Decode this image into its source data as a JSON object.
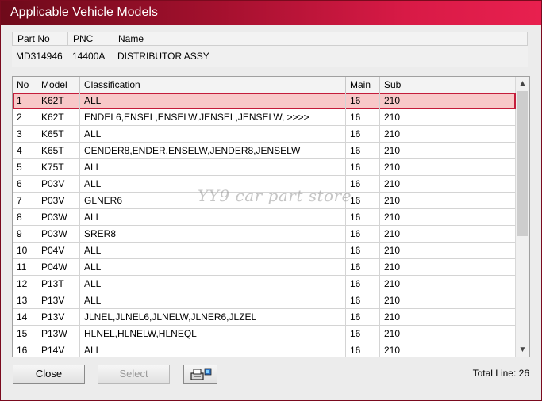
{
  "window": {
    "title": "Applicable Vehicle Models"
  },
  "part_header": {
    "columns": [
      "Part No",
      "PNC",
      "Name"
    ],
    "values": [
      "MD314946",
      "14400A",
      "DISTRIBUTOR ASSY"
    ]
  },
  "grid": {
    "columns": [
      "No",
      "Model",
      "Classification",
      "Main",
      "Sub"
    ],
    "rows": [
      {
        "no": "1",
        "model": "K62T",
        "classification": "ALL",
        "main": "16",
        "sub": "210"
      },
      {
        "no": "2",
        "model": "K62T",
        "classification": "ENDEL6,ENSEL,ENSELW,JENSEL,JENSELW,  >>>>",
        "main": "16",
        "sub": "210"
      },
      {
        "no": "3",
        "model": "K65T",
        "classification": "ALL",
        "main": "16",
        "sub": "210"
      },
      {
        "no": "4",
        "model": "K65T",
        "classification": "CENDER8,ENDER,ENSELW,JENDER8,JENSELW",
        "main": "16",
        "sub": "210"
      },
      {
        "no": "5",
        "model": "K75T",
        "classification": "ALL",
        "main": "16",
        "sub": "210"
      },
      {
        "no": "6",
        "model": "P03V",
        "classification": "ALL",
        "main": "16",
        "sub": "210"
      },
      {
        "no": "7",
        "model": "P03V",
        "classification": "GLNER6",
        "main": "16",
        "sub": "210"
      },
      {
        "no": "8",
        "model": "P03W",
        "classification": "ALL",
        "main": "16",
        "sub": "210"
      },
      {
        "no": "9",
        "model": "P03W",
        "classification": "SRER8",
        "main": "16",
        "sub": "210"
      },
      {
        "no": "10",
        "model": "P04V",
        "classification": "ALL",
        "main": "16",
        "sub": "210"
      },
      {
        "no": "11",
        "model": "P04W",
        "classification": "ALL",
        "main": "16",
        "sub": "210"
      },
      {
        "no": "12",
        "model": "P13T",
        "classification": "ALL",
        "main": "16",
        "sub": "210"
      },
      {
        "no": "13",
        "model": "P13V",
        "classification": "ALL",
        "main": "16",
        "sub": "210"
      },
      {
        "no": "14",
        "model": "P13V",
        "classification": "JLNEL,JLNEL6,JLNELW,JLNER6,JLZEL",
        "main": "16",
        "sub": "210"
      },
      {
        "no": "15",
        "model": "P13W",
        "classification": "HLNEL,HLNELW,HLNEQL",
        "main": "16",
        "sub": "210"
      },
      {
        "no": "16",
        "model": "P14V",
        "classification": "ALL",
        "main": "16",
        "sub": "210"
      }
    ],
    "selected_row": 1
  },
  "watermark": "YY9 car part store",
  "buttons": {
    "close": "Close",
    "select": "Select"
  },
  "icons": {
    "print": "printer-icon",
    "scroll_up": "scroll-up-icon",
    "scroll_down": "scroll-down-icon"
  },
  "footer": {
    "total_line": "Total Line: 26"
  },
  "colors": {
    "title_start": "#6e0a1a",
    "title_end": "#e8204f",
    "selection_fill": "#f8c8c8",
    "selection_border": "#c41c3a"
  }
}
